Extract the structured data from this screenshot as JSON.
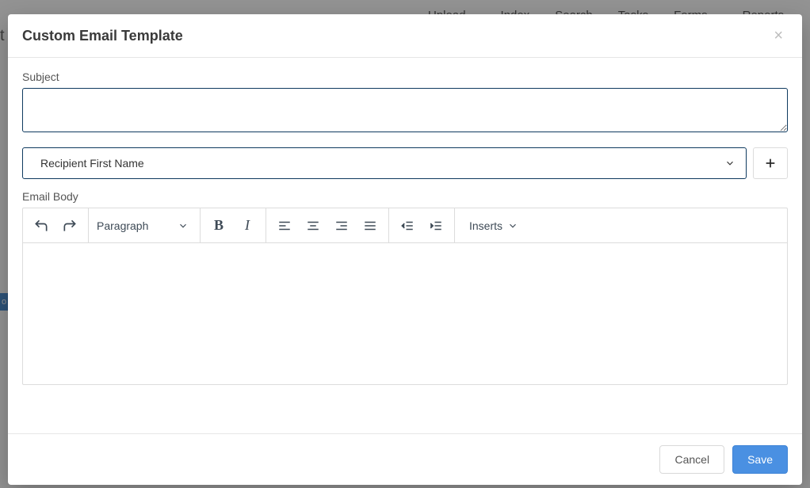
{
  "bg_nav": {
    "upload": "Upload",
    "index": "Index",
    "search": "Search",
    "tasks": "Tasks",
    "forms": "Forms",
    "reports": "Reports"
  },
  "bg": {
    "title_fragment": "t",
    "badge_fragment": "o"
  },
  "modal": {
    "title": "Custom Email Template",
    "subject_label": "Subject",
    "subject_value": "",
    "variable_selected": "Recipient First Name",
    "body_label": "Email Body",
    "body_value": ""
  },
  "toolbar": {
    "format_label": "Paragraph",
    "inserts_label": "Inserts"
  },
  "footer": {
    "cancel": "Cancel",
    "save": "Save"
  }
}
